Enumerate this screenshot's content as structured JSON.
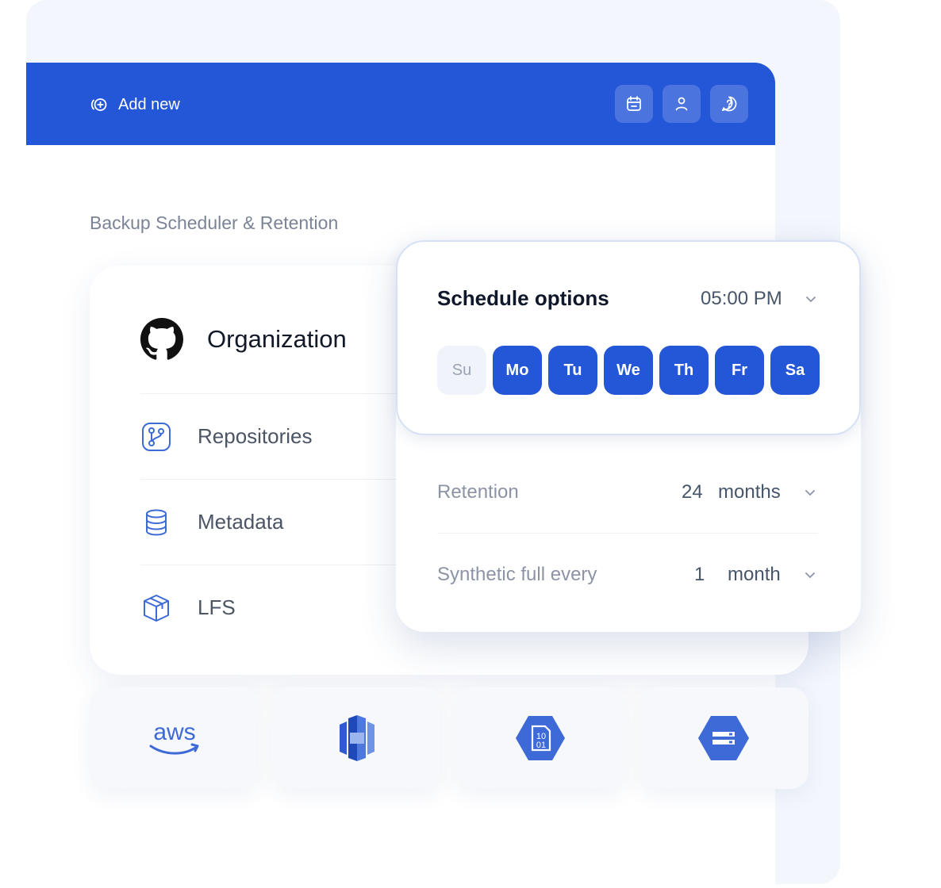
{
  "header": {
    "add_new_label": "Add new",
    "icons": [
      "calendar-icon",
      "user-icon",
      "help-icon"
    ]
  },
  "section": {
    "title": "Backup Scheduler & Retention"
  },
  "organization": {
    "title": "Organization",
    "items": [
      {
        "label": "Repositories",
        "icon": "git-branch-icon"
      },
      {
        "label": "Metadata",
        "icon": "database-icon"
      },
      {
        "label": "LFS",
        "icon": "package-icon"
      }
    ]
  },
  "schedule": {
    "title": "Schedule options",
    "time": "05:00 PM",
    "days": [
      {
        "label": "Su",
        "selected": false
      },
      {
        "label": "Mo",
        "selected": true
      },
      {
        "label": "Tu",
        "selected": true
      },
      {
        "label": "We",
        "selected": true
      },
      {
        "label": "Th",
        "selected": true
      },
      {
        "label": "Fr",
        "selected": true
      },
      {
        "label": "Sa",
        "selected": true
      }
    ]
  },
  "retention": {
    "label": "Retention",
    "value": "24",
    "unit": "months"
  },
  "synthetic": {
    "label": "Synthetic full every",
    "value": "1",
    "unit": "month"
  },
  "providers": [
    "aws-logo",
    "aws-s3-logo",
    "azure-blob-storage-logo",
    "google-cloud-storage-logo"
  ],
  "colors": {
    "accent": "#2456d8",
    "background": "#f3f6fc",
    "text_dark": "#0f172a",
    "text_muted": "#8b93a5"
  }
}
